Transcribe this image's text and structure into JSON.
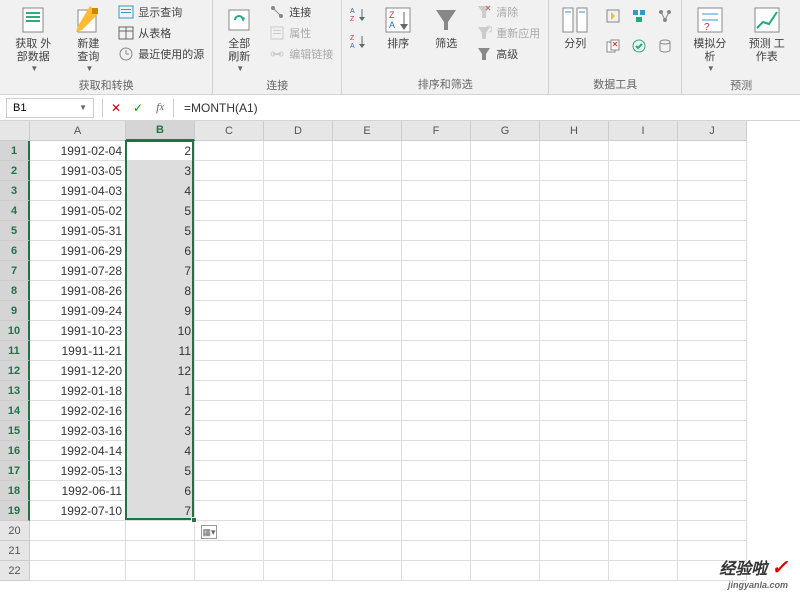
{
  "ribbon": {
    "groups": [
      {
        "label": "获取和转换",
        "large": [
          {
            "label": "获取\n外部数据",
            "icon": "external-data"
          },
          {
            "label": "新建\n查询",
            "icon": "new-query"
          }
        ],
        "small": [
          {
            "label": "显示查询",
            "icon": "show-queries"
          },
          {
            "label": "从表格",
            "icon": "from-table"
          },
          {
            "label": "最近使用的源",
            "icon": "recent-sources"
          }
        ]
      },
      {
        "label": "连接",
        "large": [
          {
            "label": "全部刷新",
            "icon": "refresh-all"
          }
        ],
        "small": [
          {
            "label": "连接",
            "icon": "connections"
          },
          {
            "label": "属性",
            "icon": "properties",
            "disabled": true
          },
          {
            "label": "编辑链接",
            "icon": "edit-links",
            "disabled": true
          }
        ]
      },
      {
        "label": "排序和筛选",
        "large": [
          {
            "label": "",
            "icon": "sort-az"
          },
          {
            "label": "",
            "icon": "sort-za"
          },
          {
            "label": "排序",
            "icon": "sort"
          },
          {
            "label": "筛选",
            "icon": "filter"
          }
        ],
        "small": [
          {
            "label": "清除",
            "icon": "clear",
            "disabled": true
          },
          {
            "label": "重新应用",
            "icon": "reapply",
            "disabled": true
          },
          {
            "label": "高级",
            "icon": "advanced"
          }
        ]
      },
      {
        "label": "数据工具",
        "large": [
          {
            "label": "分列",
            "icon": "text-to-columns"
          }
        ],
        "grid_icons": [
          "flash-fill",
          "remove-dup",
          "data-validation",
          "consolidate",
          "relationships",
          "manage-model"
        ]
      },
      {
        "label": "预测",
        "large": [
          {
            "label": "模拟分析",
            "icon": "what-if"
          },
          {
            "label": "预测\n工作表",
            "icon": "forecast"
          }
        ]
      }
    ]
  },
  "formula_bar": {
    "name_box": "B1",
    "formula": "=MONTH(A1)"
  },
  "columns": [
    "A",
    "B",
    "C",
    "D",
    "E",
    "F",
    "G",
    "H",
    "I",
    "J"
  ],
  "selected_col_index": 1,
  "rows": [
    {
      "n": 1,
      "a": "1991-02-04",
      "b": "2"
    },
    {
      "n": 2,
      "a": "1991-03-05",
      "b": "3"
    },
    {
      "n": 3,
      "a": "1991-04-03",
      "b": "4"
    },
    {
      "n": 4,
      "a": "1991-05-02",
      "b": "5"
    },
    {
      "n": 5,
      "a": "1991-05-31",
      "b": "5"
    },
    {
      "n": 6,
      "a": "1991-06-29",
      "b": "6"
    },
    {
      "n": 7,
      "a": "1991-07-28",
      "b": "7"
    },
    {
      "n": 8,
      "a": "1991-08-26",
      "b": "8"
    },
    {
      "n": 9,
      "a": "1991-09-24",
      "b": "9"
    },
    {
      "n": 10,
      "a": "1991-10-23",
      "b": "10"
    },
    {
      "n": 11,
      "a": "1991-11-21",
      "b": "11"
    },
    {
      "n": 12,
      "a": "1991-12-20",
      "b": "12"
    },
    {
      "n": 13,
      "a": "1992-01-18",
      "b": "1"
    },
    {
      "n": 14,
      "a": "1992-02-16",
      "b": "2"
    },
    {
      "n": 15,
      "a": "1992-03-16",
      "b": "3"
    },
    {
      "n": 16,
      "a": "1992-04-14",
      "b": "4"
    },
    {
      "n": 17,
      "a": "1992-05-13",
      "b": "5"
    },
    {
      "n": 18,
      "a": "1992-06-11",
      "b": "6"
    },
    {
      "n": 19,
      "a": "1992-07-10",
      "b": "7"
    }
  ],
  "empty_rows": [
    20,
    21,
    22
  ],
  "watermark": {
    "text": "经验啦",
    "url": "jingyanla.com"
  }
}
